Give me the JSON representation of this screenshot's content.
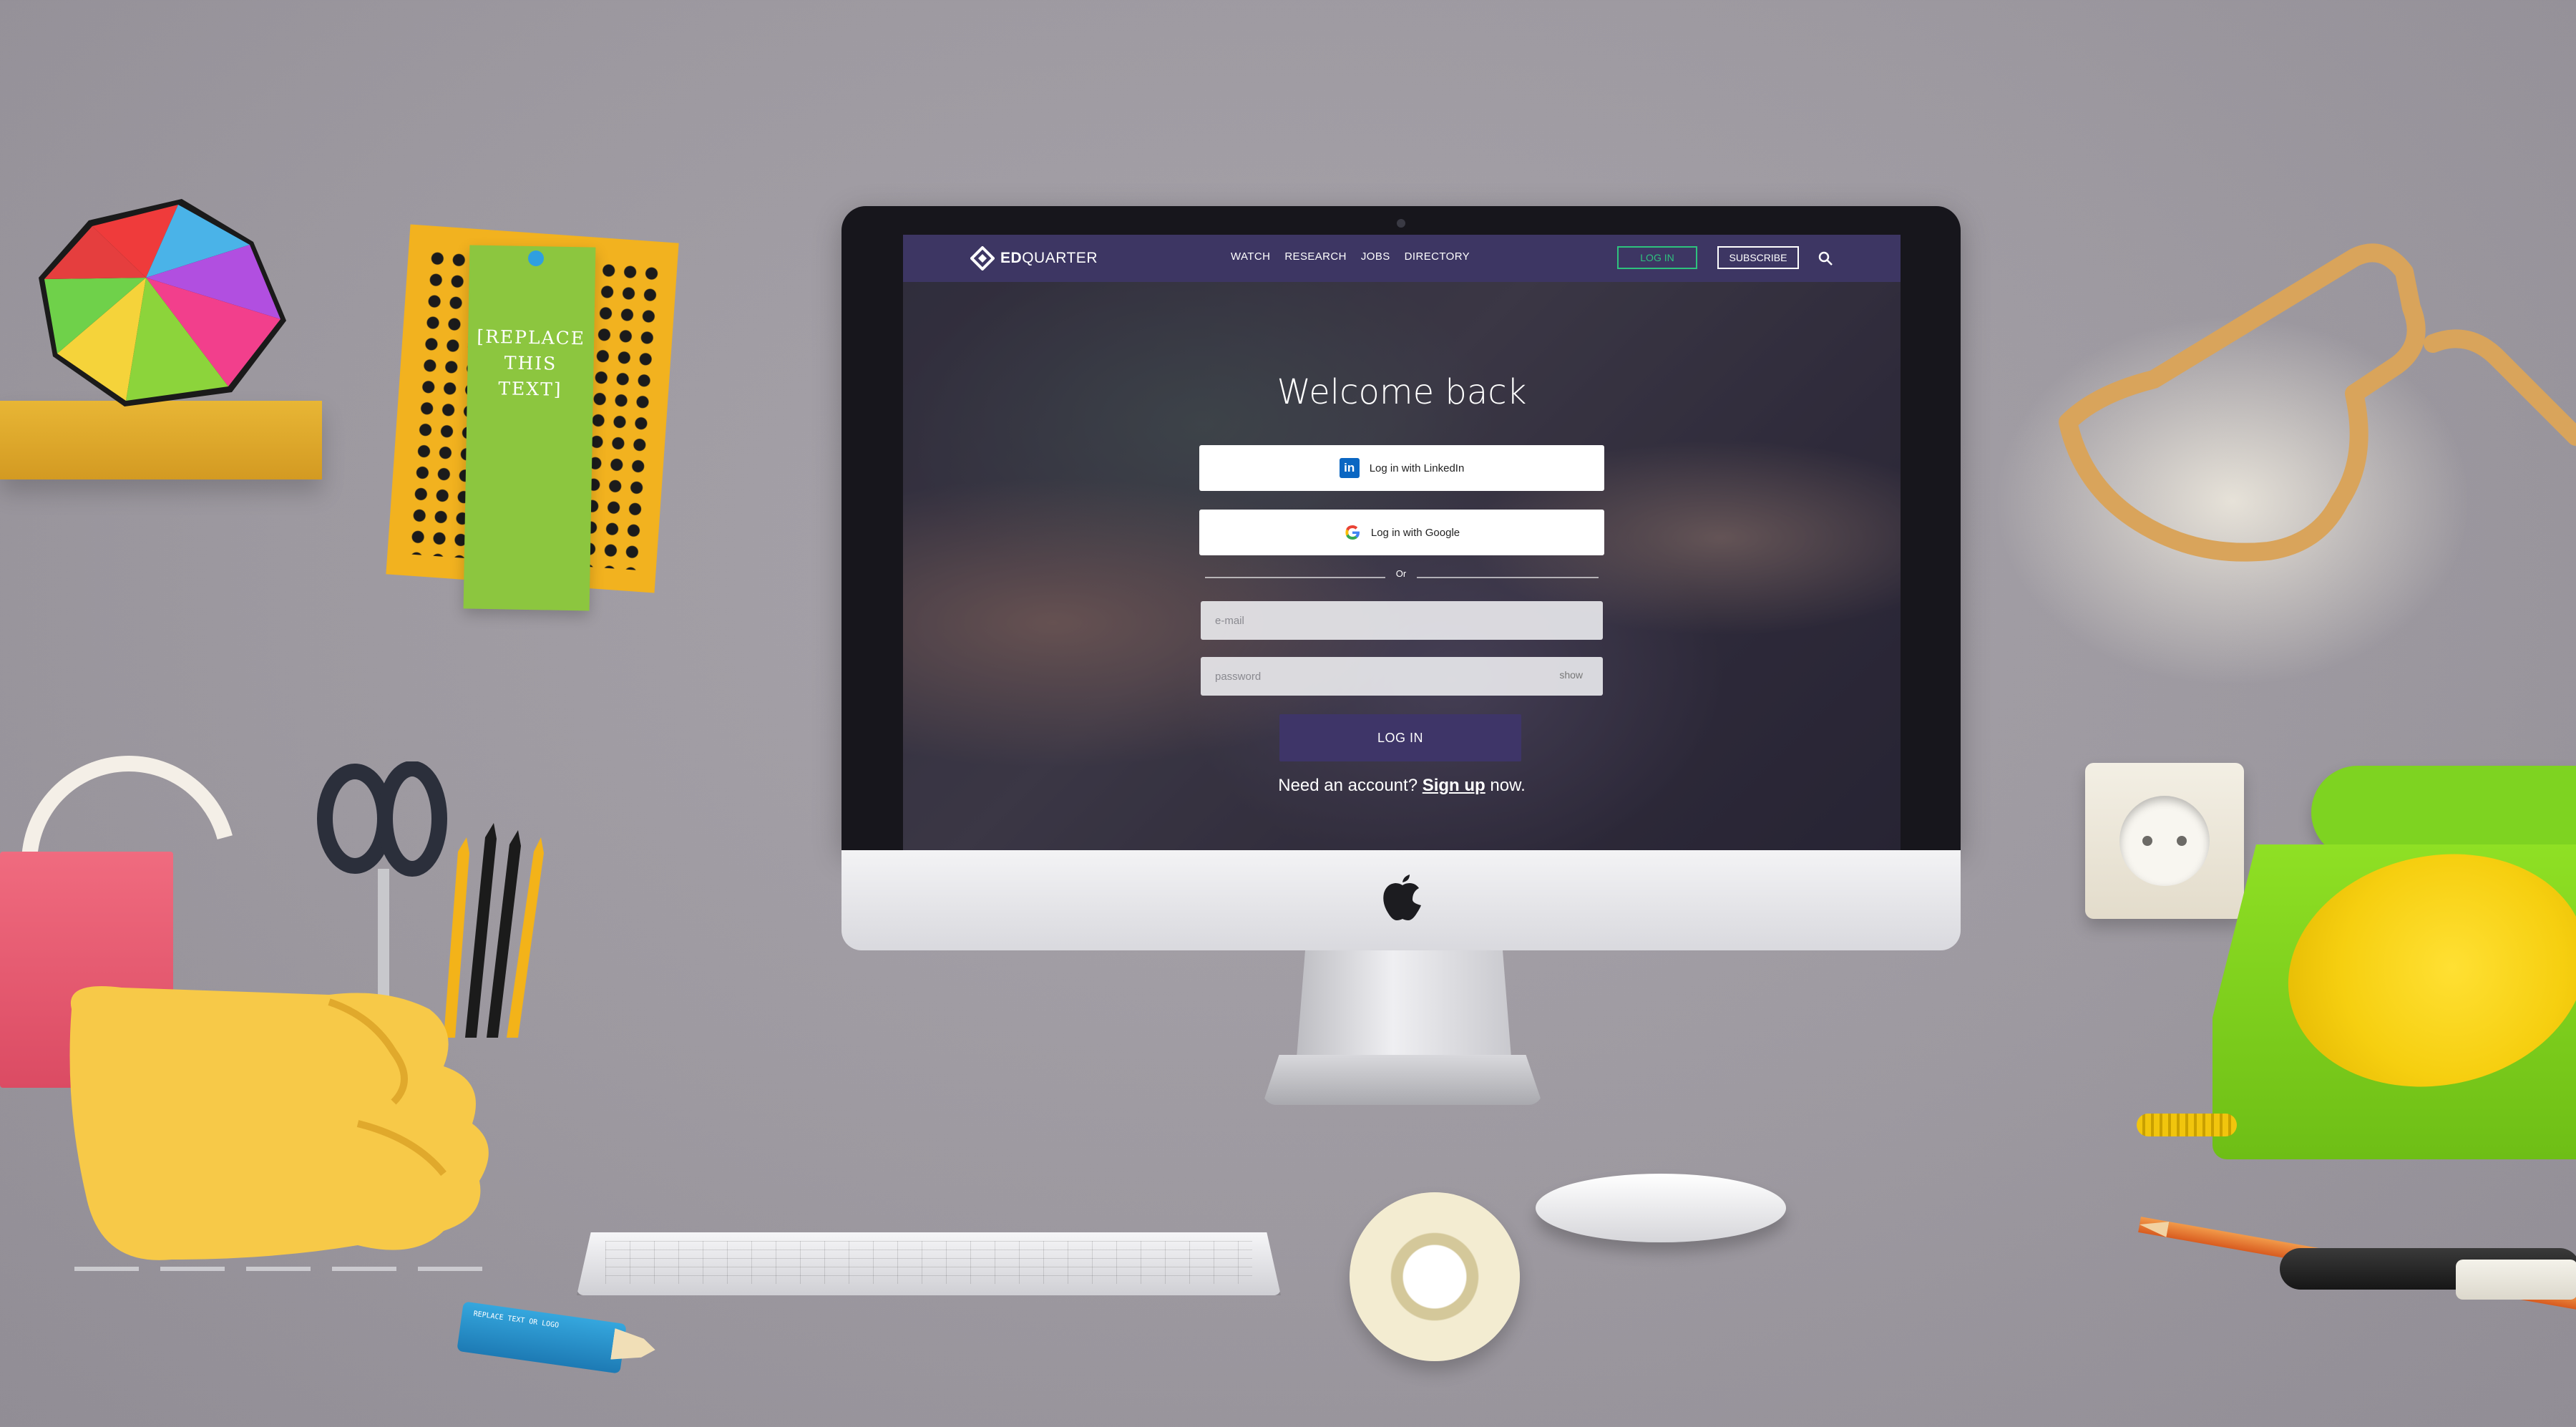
{
  "site": {
    "logo_bold": "ED",
    "logo_rest": "QUARTER",
    "nav_links": [
      "WATCH",
      "RESEARCH",
      "JOBS",
      "DIRECTORY"
    ],
    "login_label": "LOG IN",
    "subscribe_label": "SUBSCRIBE"
  },
  "login": {
    "heading": "Welcome back",
    "linkedin_label": "Log in with LinkedIn",
    "linkedin_icon_text": "in",
    "google_label": "Log in with Google",
    "divider_text": "Or",
    "email_placeholder": "e-mail",
    "password_placeholder": "password",
    "show_label": "show",
    "submit_label": "LOG IN",
    "signup_prefix": "Need an account?",
    "signup_link": "Sign up",
    "signup_suffix": "now."
  },
  "props": {
    "bookmark_line1": "[REPLACE",
    "bookmark_line2": "THIS",
    "bookmark_line3": "TEXT]",
    "marker_text": "REPLACE TEXT OR LOGO"
  },
  "colors": {
    "nav_bg": "#3d3663",
    "login_button": "#3e3568",
    "nav_login_accent": "#2ec27e",
    "linkedin": "#0a66c2"
  },
  "icons": [
    "apple-icon",
    "search-icon",
    "linkedin-icon",
    "google-icon",
    "edquarter-logo-icon"
  ]
}
